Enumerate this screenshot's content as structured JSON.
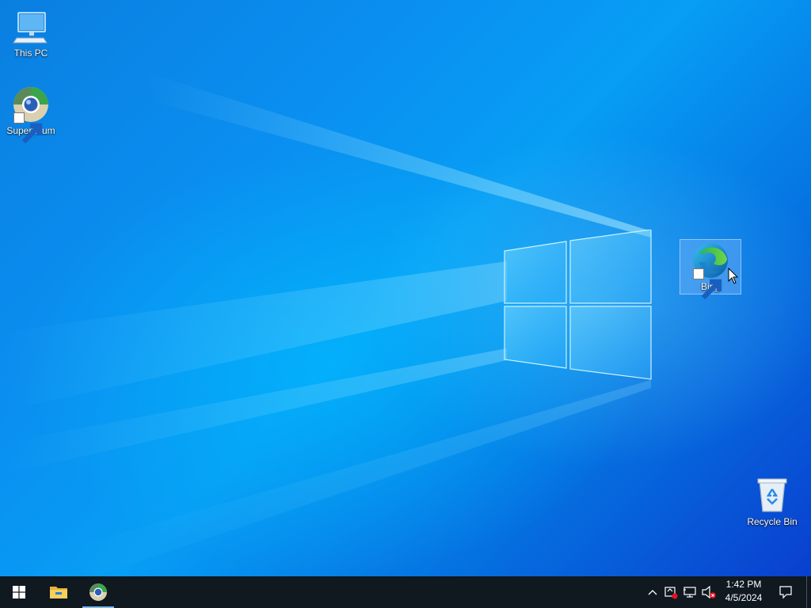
{
  "desktop": {
    "icons": [
      {
        "label": "This PC",
        "icon": "computer-icon"
      },
      {
        "label": "Supermium",
        "icon": "supermium-browser-icon"
      },
      {
        "label": "Bing",
        "icon": "edge-browser-icon",
        "selected": true
      },
      {
        "label": "Recycle Bin",
        "icon": "recycle-bin-icon"
      }
    ]
  },
  "taskbar": {
    "start": {
      "icon": "windows-start-icon"
    },
    "pinned": [
      {
        "icon": "file-explorer-icon"
      },
      {
        "icon": "supermium-browser-icon",
        "active": true
      }
    ],
    "tray": {
      "icons": [
        "chevron-up-icon",
        "security-alert-icon",
        "network-disconnected-icon",
        "volume-muted-icon"
      ],
      "time": "1:42 PM",
      "date": "4/5/2024"
    },
    "notifications_icon": "action-center-icon"
  },
  "colors": {
    "taskbar": "#101820",
    "desktop_accent": "#0a8ff0",
    "selection": "#8cbeff"
  }
}
